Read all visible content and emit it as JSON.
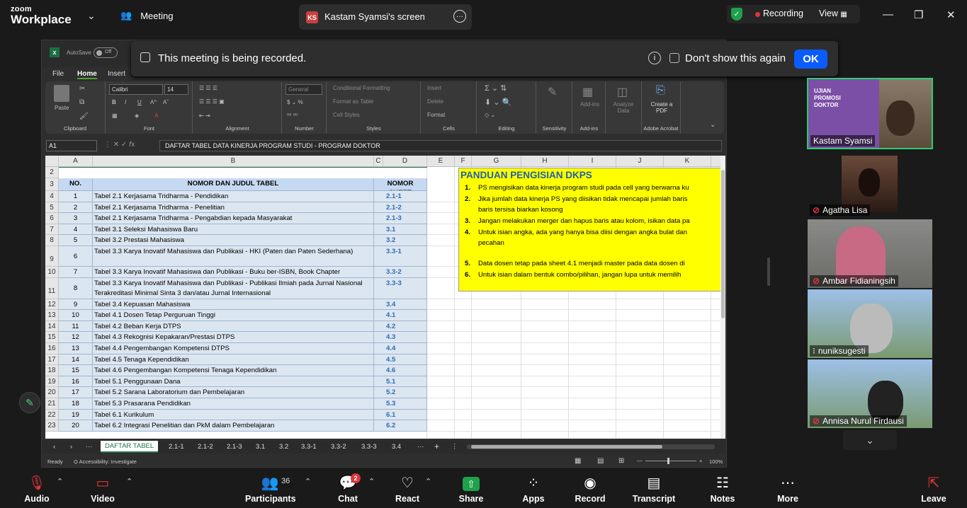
{
  "topbar": {
    "logo_top": "zoom",
    "logo_bottom": "Workplace",
    "meeting_label": "Meeting",
    "share_initials": "KS",
    "share_title": "Kastam Syamsi's screen",
    "recording_label": "Recording",
    "view_label": "View"
  },
  "banner": {
    "message": "This meeting is being recorded.",
    "dont_show": "Don't show this again",
    "ok": "OK"
  },
  "excel": {
    "autosave": "AutoSave",
    "toggle": "Off",
    "tabs": [
      "File",
      "Home",
      "Insert"
    ],
    "ribbon": {
      "clipboard": "Clipboard",
      "paste": "Paste",
      "font": "Font",
      "font_name": "Calibri",
      "font_size": "14",
      "alignment": "Alignment",
      "number": "Number",
      "number_format": "General",
      "styles": "Styles",
      "cond_format": "Conditional Formatting",
      "format_table": "Format as Table",
      "cell_styles": "Cell Styles",
      "cells": "Cells",
      "insert": "Insert",
      "delete": "Delete",
      "format": "Format",
      "editing": "Editing",
      "sensitivity": "Sensitivity",
      "addins": "Add-ins",
      "addins_btn": "Add-ins",
      "analyze": "Analyze Data",
      "acrobat": "Adobe Acrobat",
      "create_pdf": "Create a PDF"
    },
    "name_box": "A1",
    "formula": "DAFTAR TABEL DATA KINERJA PROGRAM STUDI - PROGRAM DOKTOR",
    "columns": [
      "A",
      "B",
      "C",
      "D",
      "E",
      "F",
      "G",
      "H",
      "I",
      "J",
      "K"
    ],
    "header": {
      "no": "NO.",
      "judul": "NOMOR DAN JUDUL TABEL",
      "sheet": "NOMOR SHEET"
    },
    "rows": [
      {
        "r": "4",
        "no": "1",
        "title": "Tabel 2.1 Kerjasama Tridharma - Pendidikan",
        "sheet": "2.1-1"
      },
      {
        "r": "5",
        "no": "2",
        "title": "Tabel 2.1 Kerjasama Tridharma - Penelitian",
        "sheet": "2.1-2"
      },
      {
        "r": "6",
        "no": "3",
        "title": "Tabel 2.1 Kerjasama Tridharma - Pengabdian kepada Masyarakat",
        "sheet": "2.1-3"
      },
      {
        "r": "7",
        "no": "4",
        "title": "Tabel 3.1 Seleksi Mahasiswa Baru",
        "sheet": "3.1"
      },
      {
        "r": "8",
        "no": "5",
        "title": "Tabel 3.2 Prestasi Mahasiswa",
        "sheet": "3.2"
      },
      {
        "r": "9",
        "no": "6",
        "title": "Tabel 3.3 Karya Inovatif Mahasiswa dan Publikasi - HKI (Paten dan Paten Sederhana)",
        "sheet": "3.3-1"
      },
      {
        "r": "10",
        "no": "7",
        "title": "Tabel 3.3 Karya Inovatif Mahasiswa dan Publikasi -  Buku ber-ISBN, Book Chapter",
        "sheet": "3.3-2"
      },
      {
        "r": "11",
        "no": "8",
        "title": "Tabel 3.3 Karya Inovatif Mahasiswa dan Publikasi - Publikasi Ilmiah pada Jurnal Nasional Terakreditasi Minimal Sinta 3 dan/atau Jurnal Internasional",
        "sheet": "3.3-3"
      },
      {
        "r": "12",
        "no": "9",
        "title": "Tabel 3.4 Kepuasan Mahasiswa",
        "sheet": "3.4"
      },
      {
        "r": "13",
        "no": "10",
        "title": "Tabel 4.1 Dosen Tetap Perguruan Tinggi",
        "sheet": "4.1"
      },
      {
        "r": "14",
        "no": "11",
        "title": "Tabel 4.2 Beban Kerja DTPS",
        "sheet": "4.2"
      },
      {
        "r": "15",
        "no": "12",
        "title": "Tabel 4.3 Rekognisi Kepakaran/Prestasi DTPS",
        "sheet": "4.3"
      },
      {
        "r": "16",
        "no": "13",
        "title": "Tabel 4.4 Pengembangan Kompetensi DTPS",
        "sheet": "4.4"
      },
      {
        "r": "17",
        "no": "14",
        "title": "Tabel 4.5 Tenaga Kependidikan",
        "sheet": "4.5"
      },
      {
        "r": "18",
        "no": "15",
        "title": "Tabel 4.6 Pengembangan Kompetensi Tenaga Kependidikan",
        "sheet": "4.6"
      },
      {
        "r": "19",
        "no": "16",
        "title": "Tabel 5.1 Penggunaan Dana",
        "sheet": "5.1"
      },
      {
        "r": "20",
        "no": "17",
        "title": "Tabel 5.2 Sarana Laboratorium dan Pembelajaran",
        "sheet": "5.2"
      },
      {
        "r": "21",
        "no": "18",
        "title": "Tabel 5.3 Prasarana Pendidikan",
        "sheet": "5.3"
      },
      {
        "r": "22",
        "no": "19",
        "title": "Tabel 6.1 Kurikulum",
        "sheet": "6.1"
      },
      {
        "r": "23",
        "no": "20",
        "title": "Tabel 6.2 Integrasi Penelitian dan PkM dalam Pembelajaran",
        "sheet": "6.2"
      }
    ],
    "panduan": {
      "title": "PANDUAN PENGISIAN DKPS",
      "items": [
        {
          "n": "1.",
          "t": "PS mengisikan data kinerja program studi pada cell  yang berwarna ku"
        },
        {
          "n": "2.",
          "t": "Jika jumlah data kinerja PS yang diisikan tidak mencapai jumlah baris"
        },
        {
          "n": "",
          "t": "baris tersisa biarkan kosong"
        },
        {
          "n": "3.",
          "t": "Jangan melakukan merger dan hapus baris atau kolom, isikan data pa"
        },
        {
          "n": "4.",
          "t": "Untuk isian angka, ada yang hanya bisa diisi dengan angka bulat dan"
        },
        {
          "n": "",
          "t": "pecahan"
        },
        {
          "n": "5.",
          "t": "Data dosen tetap pada sheet  4.1 menjadi master pada data dosen di"
        },
        {
          "n": "6.",
          "t": "Untuk isian dalam bentuk combo/pilihan, jangan lupa untuk memilih"
        }
      ]
    },
    "sheet_tabs": [
      "DAFTAR TABEL",
      "2.1-1",
      "2.1-2",
      "2.1-3",
      "3.1",
      "3.2",
      "3.3-1",
      "3.3-2",
      "3.3-3",
      "3.4"
    ],
    "status_ready": "Ready",
    "status_access": "Accessibility: Investigate",
    "zoom": "100%"
  },
  "participants": [
    {
      "name": "Kastam Syamsi",
      "slide": "UJIAN PROMOSI DOKTOR"
    },
    {
      "name": "Agatha Lisa"
    },
    {
      "name": "Ambar Fidianingsih"
    },
    {
      "name": "nuniksugesti"
    },
    {
      "name": "Annisa Nurul Firdausi"
    }
  ],
  "toolbar": {
    "audio": "Audio",
    "video": "Video",
    "participants": "Participants",
    "participants_count": "36",
    "chat": "Chat",
    "chat_badge": "2",
    "react": "React",
    "share": "Share",
    "apps": "Apps",
    "record": "Record",
    "transcript": "Transcript",
    "notes": "Notes",
    "more": "More",
    "leave": "Leave"
  }
}
